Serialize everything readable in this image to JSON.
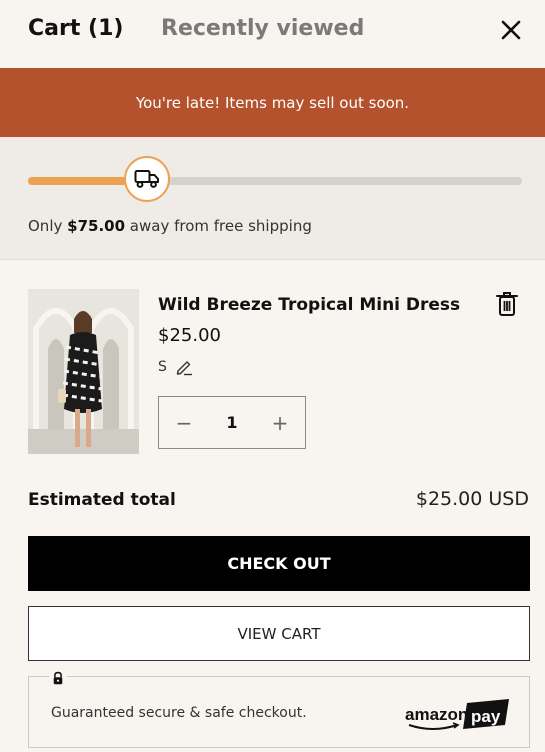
{
  "tabs": {
    "cart_label": "Cart (1)",
    "recent_label": "Recently viewed"
  },
  "banner": {
    "text": "You're late! Items may sell out soon."
  },
  "shipping": {
    "progress_percent": 24,
    "prefix": "Only ",
    "amount": "$75.00",
    "suffix": " away from free shipping",
    "accent_color": "#eda152"
  },
  "cart": {
    "items": [
      {
        "title": "Wild Breeze Tropical Mini Dress",
        "price": "$25.00",
        "size": "S",
        "quantity": "1"
      }
    ]
  },
  "summary": {
    "total_label": "Estimated total",
    "total_value": "$25.00 USD"
  },
  "buttons": {
    "checkout": "CHECK OUT",
    "view_cart": "VIEW CART"
  },
  "secure": {
    "text": "Guaranteed secure & safe checkout.",
    "logo_text": "amazon",
    "logo_badge": "pay"
  },
  "colors": {
    "banner": "#b5522e",
    "checkout_bg": "#000000"
  }
}
